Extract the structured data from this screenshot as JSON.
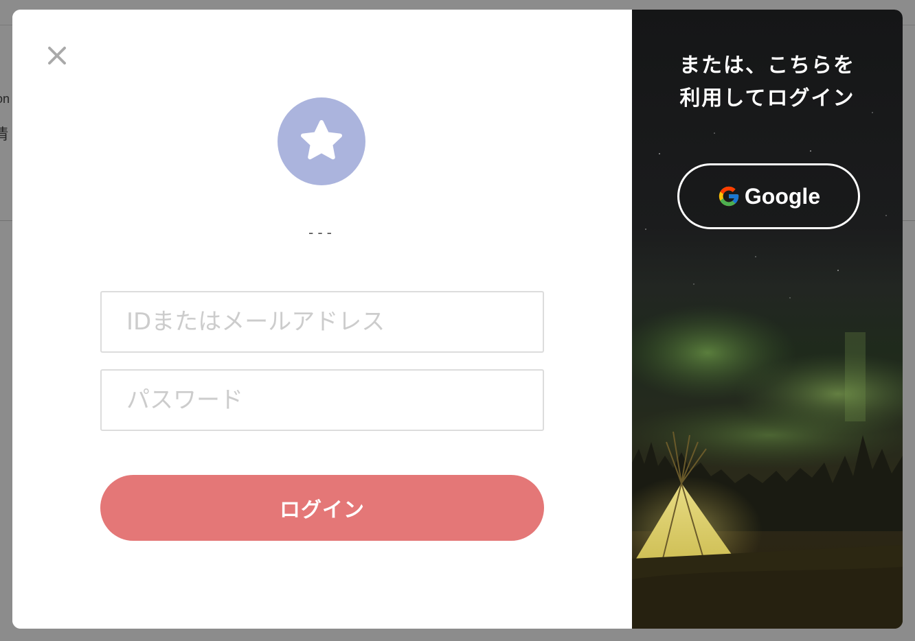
{
  "background_page": {
    "text_1": "on",
    "text_2": "情"
  },
  "modal": {
    "close_icon": "close-icon",
    "avatar_icon": "star-icon",
    "avatar_color": "#abb4dd",
    "username": "---",
    "id_field": {
      "placeholder": "IDまたはメールアドレス",
      "value": ""
    },
    "password_field": {
      "placeholder": "パスワード",
      "value": ""
    },
    "login_button_label": "ログイン",
    "login_button_color": "#e47777"
  },
  "social_panel": {
    "title": "または、こちらを\n利用してログイン",
    "google_button_label": "Google",
    "google_icon": "google-icon"
  }
}
